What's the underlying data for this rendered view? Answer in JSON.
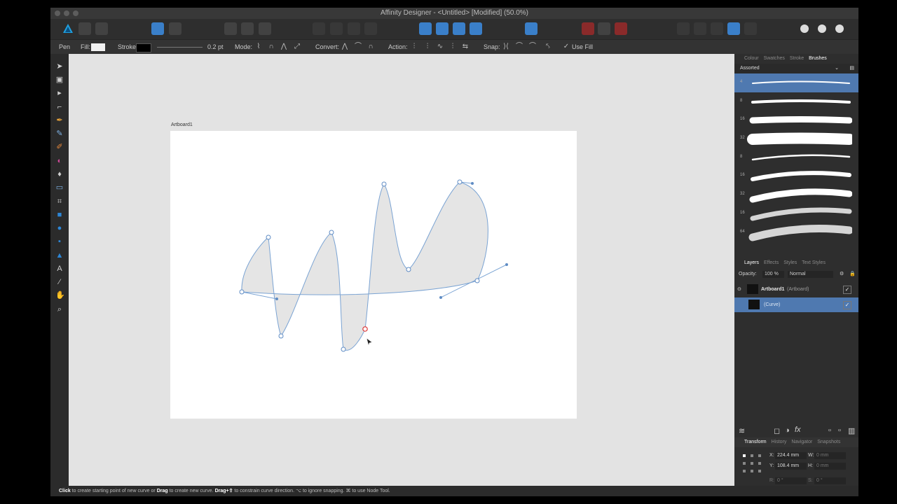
{
  "window": {
    "title": "Affinity Designer - <Untitled> [Modified] (50.0%)"
  },
  "context": {
    "tool": "Pen",
    "fill_label": "Fill:",
    "stroke_label": "Stroke:",
    "stroke_width": "0.2 pt",
    "mode_label": "Mode:",
    "convert_label": "Convert:",
    "action_label": "Action:",
    "snap_label": "Snap:",
    "use_fill": "Use Fill",
    "fill_color": "#f2f2f2",
    "stroke_color": "#000000"
  },
  "canvas": {
    "artboard_label": "Artboard1"
  },
  "status": {
    "click": "Click",
    "text1": " to create starting point of new curve or ",
    "drag": "Drag",
    "text2": " to create new curve. ",
    "drag_shift": "Drag+⇧",
    "text3": " to constrain curve direction. ⌥ to ignore snapping. ⌘ to use Node Tool."
  },
  "brushes_panel": {
    "tabs": [
      "Colour",
      "Swatches",
      "Stroke",
      "Brushes"
    ],
    "active_tab": "Brushes",
    "category": "Assorted",
    "sizes": [
      "4",
      "8",
      "16",
      "32",
      "8",
      "16",
      "32",
      "16",
      "64"
    ]
  },
  "layers_panel": {
    "tabs": [
      "Layers",
      "Effects",
      "Styles",
      "Text Styles"
    ],
    "opacity_label": "Opacity:",
    "opacity": "100 %",
    "blend": "Normal",
    "layers": [
      {
        "name": "Artboard1",
        "kind": "(Artboard)"
      },
      {
        "name": "",
        "kind": "(Curve)"
      }
    ]
  },
  "transform_panel": {
    "tabs": [
      "Transform",
      "History",
      "Navigator",
      "Snapshots"
    ],
    "x_label": "X:",
    "x": "224.4 mm",
    "y_label": "Y:",
    "y": "108.4 mm",
    "w_label": "W:",
    "w": "0 mm",
    "h_label": "H:",
    "h": "0 mm",
    "r_label": "R:",
    "r": "0 °",
    "s_label": "S:",
    "s": "0 °"
  },
  "colors": {
    "accent": "#4f79b0",
    "brand": "#3a7fc9"
  }
}
